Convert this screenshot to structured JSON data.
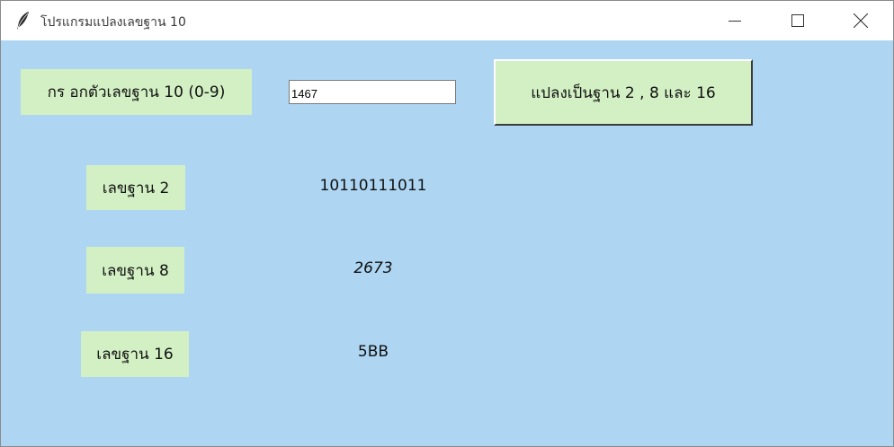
{
  "window": {
    "title": "โปรแกรมแปลงเลขฐาน 10",
    "app_icon": "feather-icon",
    "controls": [
      "minimize-icon",
      "maximize-icon",
      "close-icon"
    ]
  },
  "colors": {
    "background": "#aed6f3",
    "label_background": "#d3f0c4",
    "titlebar": "#ffffff"
  },
  "input": {
    "label": "กร อกตัวเลขฐาน 10 (0-9)",
    "value": "1467"
  },
  "convert_button": {
    "label": "แปลงเป็นฐาน 2 , 8 และ 16"
  },
  "results": [
    {
      "label": "เลขฐาน 2",
      "value": "10110111011"
    },
    {
      "label": "เลขฐาน 8",
      "value": "2673"
    },
    {
      "label": "เลขฐาน 16",
      "value": "5BB"
    }
  ]
}
